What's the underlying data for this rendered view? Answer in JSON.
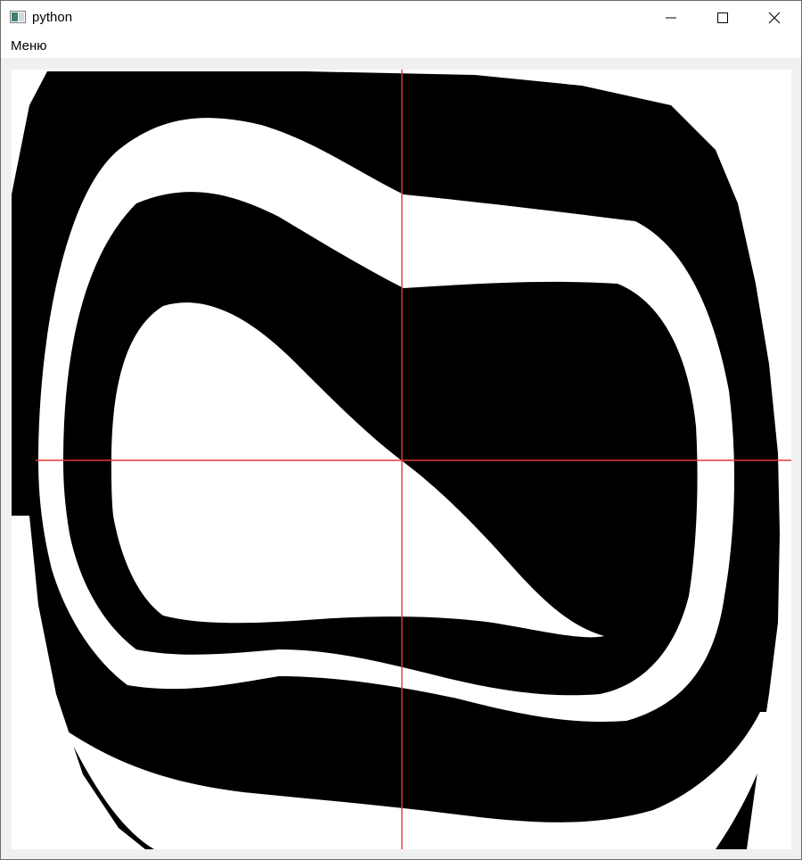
{
  "window": {
    "title": "python",
    "icon": "python-app-icon",
    "controls": {
      "minimize": "minimize-icon",
      "maximize": "maximize-icon",
      "close": "close-icon"
    }
  },
  "menubar": {
    "items": [
      {
        "label": "Меню"
      }
    ]
  },
  "plot": {
    "colors": {
      "foreground": "#000000",
      "background": "#ffffff",
      "crosshair": "#e53935"
    }
  }
}
